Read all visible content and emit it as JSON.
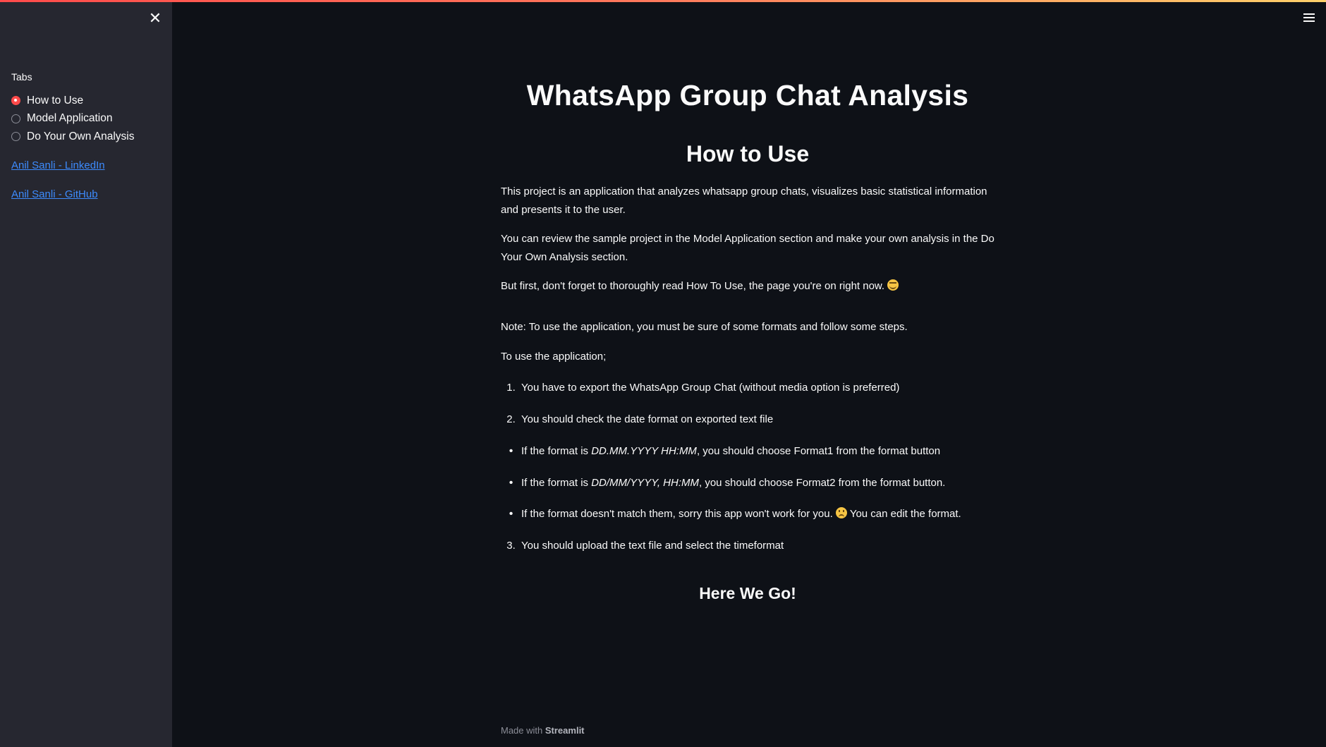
{
  "sidebar": {
    "close_icon": "close-icon",
    "tabs_label": "Tabs",
    "radio_options": [
      {
        "label": "How to Use",
        "selected": true
      },
      {
        "label": "Model Application",
        "selected": false
      },
      {
        "label": "Do Your Own Analysis",
        "selected": false
      }
    ],
    "links": [
      {
        "label": "Anil Sanli - LinkedIn"
      },
      {
        "label": "Anil Sanli - GitHub"
      }
    ]
  },
  "header": {
    "menu_icon": "hamburger-menu-icon"
  },
  "main": {
    "title": "WhatsApp Group Chat Analysis",
    "subtitle": "How to Use",
    "paragraphs": [
      "This project is an application that analyzes whatsapp group chats, visualizes basic statistical information and presents it to the user.",
      "You can review the sample project in the Model Application section and make your own analysis in the Do Your Own Analysis section.",
      "But first, don't forget to thoroughly read How To Use, the page you're on right now.",
      "Note: To use the application, you must be sure of some formats and follow some steps.",
      "To use the application;"
    ],
    "steps": [
      {
        "marker": "1.",
        "text": "You have to export the WhatsApp Group Chat (without media option is preferred)"
      },
      {
        "marker": "2.",
        "text": "You should check the date format on exported text file"
      }
    ],
    "bullets": [
      {
        "prefix": "If the format is ",
        "format": "DD.MM.YYYY HH:MM",
        "suffix": ", you should choose Format1 from the format button"
      },
      {
        "prefix": "If the format is ",
        "format": "DD/MM/YYYY, HH:MM",
        "suffix": ", you should choose Format2 from the format button."
      },
      {
        "prefix": "If the format doesn't match them, sorry this app won't work for you.",
        "suffix": "You can edit the format."
      }
    ],
    "step3": {
      "marker": "3.",
      "text": "You should upload the text file and select the timeformat"
    },
    "section_heading": "Here We Go!"
  },
  "footer": {
    "prefix": "Made with",
    "brand": "Streamlit"
  },
  "colors": {
    "accent": "#ff4b4b",
    "link": "#3d8bfd",
    "background": "#0e1117",
    "sidebar": "#262730"
  }
}
